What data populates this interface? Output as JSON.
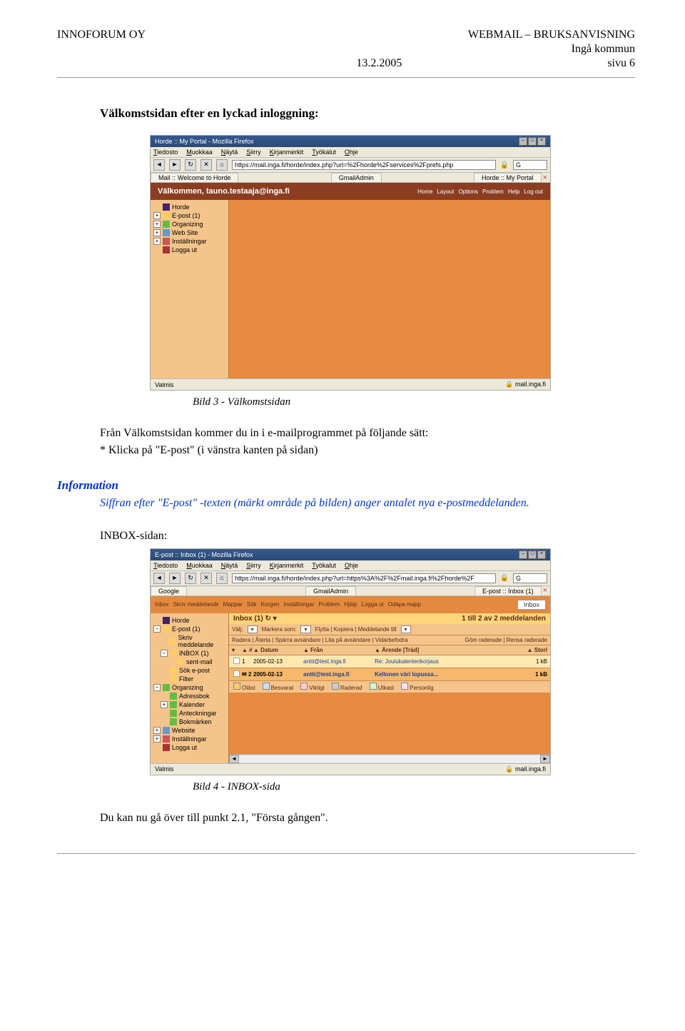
{
  "header": {
    "company": "INNOFORUM  OY",
    "doc_title": "WEBMAIL – BRUKSANVISNING",
    "entity": "Ingå kommun",
    "date": "13.2.2005",
    "page": "sivu 6"
  },
  "section1_title": "Välkomstsidan efter en lyckad inloggning:",
  "caption1": "Bild 3 - Välkomstsidan",
  "body1": "Från Välkomstsidan kommer du in i e-mailprogrammet på följande sätt:",
  "body1b": "* Klicka på \"E-post\" (i vänstra kanten på sidan)",
  "info_heading": "Information",
  "info_body": "Siffran efter \"E-post\" -texten (märkt område på bilden) anger antalet nya e-postmeddelanden.",
  "section2_label": "INBOX-sidan:",
  "caption2": "Bild 4 - INBOX-sida",
  "closing": "Du kan nu gå över till punkt 2.1, \"Första gången\".",
  "shot1": {
    "win_title": "Horde :: My Portal - Mozilla Firefox",
    "menu": [
      "Tiedosto",
      "Muokkaa",
      "Näytä",
      "Siirry",
      "Kirjanmerkit",
      "Työkalut",
      "Ohje"
    ],
    "url": "https://mail.inga.fi/horde/index.php?url=%2Fhorde%2Fservices%2Fprefs.php",
    "tabs": {
      "left_prefix": "Mail ::",
      "left": "Welcome to Horde",
      "mid": "GmailAdmin",
      "right": "Horde :: My Portal"
    },
    "welcome": "Välkommen, tauno.testaaja@inga.fi",
    "top_links": [
      "Home",
      "Layout",
      "Options",
      "Problem",
      "Help",
      "Log out"
    ],
    "tree": [
      {
        "box": "",
        "label": "Horde",
        "cls": "ic-horde"
      },
      {
        "box": "+",
        "label": "E-post (1)",
        "cls": "ic-mail"
      },
      {
        "box": "+",
        "label": "Organizing",
        "cls": "ic-org"
      },
      {
        "box": "+",
        "label": "Web Site",
        "cls": "ic-web"
      },
      {
        "box": "+",
        "label": "Inställningar",
        "cls": "ic-set"
      },
      {
        "box": "",
        "label": "Logga ut",
        "cls": "ic-logout"
      }
    ],
    "status_left": "Valmis",
    "status_right": "mail.inga.fi"
  },
  "shot2": {
    "win_title": "E-post :: Inbox (1) - Mozilla Firefox",
    "menu": [
      "Tiedosto",
      "Muokkaa",
      "Näytä",
      "Siirry",
      "Kirjanmerkit",
      "Työkalut",
      "Ohje"
    ],
    "url": "https://mail.inga.fi/horde/index.php?url=https%3A%2F%2Fmail.inga.fi%2Fhorde%2F",
    "tabs": {
      "left": "Google",
      "mid": "GmailAdmin",
      "right": "E-post :: Inbox (1)"
    },
    "toolbar_buttons": [
      "Inbox",
      "Skriv meddelande",
      "Mappar",
      "Sök",
      "Korgen",
      "Inställningar",
      "Problem",
      "Hjälp",
      "Logga ut",
      "Odäpa mapp"
    ],
    "inbox_badge": "Inbox",
    "tree": [
      {
        "box": "",
        "label": "Horde",
        "cls": "ic-horde"
      },
      {
        "box": "−",
        "label": "E-post (1)",
        "cls": "ic-mail"
      },
      {
        "box": "",
        "label": "Skriv meddelande",
        "cls": "ic-mail",
        "indent": 1
      },
      {
        "box": "−",
        "label": "INBOX (1)",
        "cls": "ic-mail",
        "indent": 1
      },
      {
        "box": "",
        "label": "sent-mail",
        "cls": "ic-mail",
        "indent": 2
      },
      {
        "box": "",
        "label": "Sök e-post",
        "cls": "ic-mail",
        "indent": 1
      },
      {
        "box": "",
        "label": "Filter",
        "cls": "ic-mail",
        "indent": 1
      },
      {
        "box": "−",
        "label": "Organizing",
        "cls": "ic-org"
      },
      {
        "box": "",
        "label": "Adressbok",
        "cls": "ic-org",
        "indent": 1
      },
      {
        "box": "+",
        "label": "Kalender",
        "cls": "ic-org",
        "indent": 1
      },
      {
        "box": "",
        "label": "Anteckningar",
        "cls": "ic-org",
        "indent": 1
      },
      {
        "box": "",
        "label": "Bokmärken",
        "cls": "ic-org",
        "indent": 1
      },
      {
        "box": "+",
        "label": "Website",
        "cls": "ic-web"
      },
      {
        "box": "+",
        "label": "Inställningar",
        "cls": "ic-set"
      },
      {
        "box": "",
        "label": "Logga ut",
        "cls": "ic-logout"
      }
    ],
    "inbox_title": "Inbox (1)",
    "inbox_count": "1 till 2 av 2 meddelanden",
    "action1_label": "Välj:",
    "action1_markera": "Markera som:",
    "action1_links": "Flytta | Kopiera | Meddelande till",
    "action2_links": "Radera | Återta | Spärra avsändare | Lita på avsändare | Vidarbefodra",
    "action2_right": "Göm raderade | Rensa raderade",
    "columns": {
      "date": "Datum",
      "from": "Från",
      "subject": "Ärende [Träd]",
      "size": "Storl"
    },
    "rows": [
      {
        "n": "1",
        "date": "2005-02-13",
        "from": "antti@test.inga.fi",
        "subject": "Re: Joulukalenterikorjaus",
        "size": "1 kB"
      },
      {
        "n": "2",
        "date": "2005-02-13",
        "from": "antti@test.inga.fi",
        "subject": "Kellonen väri lopussa...",
        "size": "1 kB"
      }
    ],
    "legend": [
      "Oläst",
      "Besvarat",
      "Viktigt",
      "Raderad",
      "Utkast",
      "Personlig"
    ],
    "status_left": "Valmis",
    "status_right": "mail.inga.fi"
  }
}
